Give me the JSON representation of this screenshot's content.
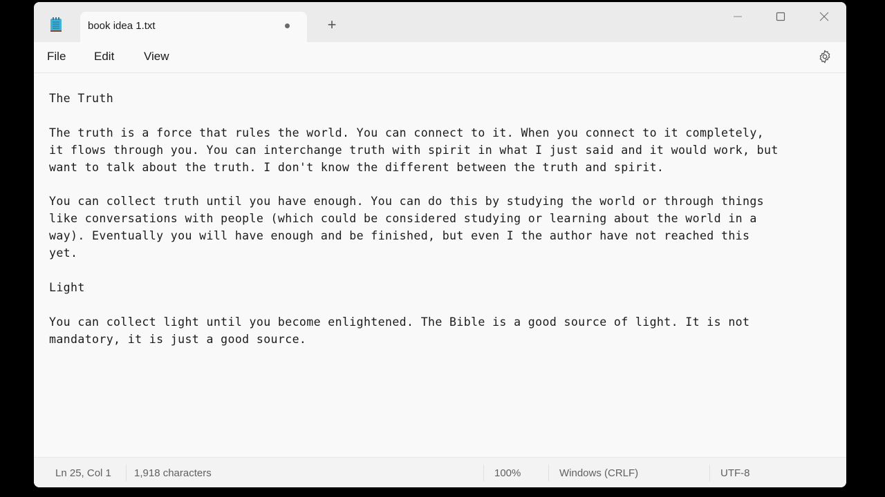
{
  "window": {
    "tab_title": "book idea 1.txt",
    "tab_unsaved_indicator": "●",
    "new_tab_label": "+",
    "controls": {
      "minimize": "minimize",
      "maximize": "maximize",
      "close": "close"
    }
  },
  "menu": {
    "items": [
      {
        "label": "File"
      },
      {
        "label": "Edit"
      },
      {
        "label": "View"
      }
    ],
    "settings_icon": "gear-icon"
  },
  "document": {
    "lines": [
      "The Truth",
      "",
      "The truth is a force that rules the world. You can connect to it. When you connect to it completely,",
      "it flows through you. You can interchange truth with spirit in what I just said and it would work, but",
      "want to talk about the truth. I don't know the different between the truth and spirit.",
      "",
      "You can collect truth until you have enough. You can do this by studying the world or through things",
      "like conversations with people (which could be considered studying or learning about the world in a",
      "way). Eventually you will have enough and be finished, but even I the author have not reached this",
      "yet.",
      "",
      "Light",
      "",
      "You can collect light until you become enlightened. The Bible is a good source of light. It is not",
      "mandatory, it is just a good source."
    ]
  },
  "status": {
    "position": "Ln 25, Col 1",
    "characters": "1,918 characters",
    "zoom": "100%",
    "line_ending": "Windows (CRLF)",
    "encoding": "UTF-8"
  }
}
